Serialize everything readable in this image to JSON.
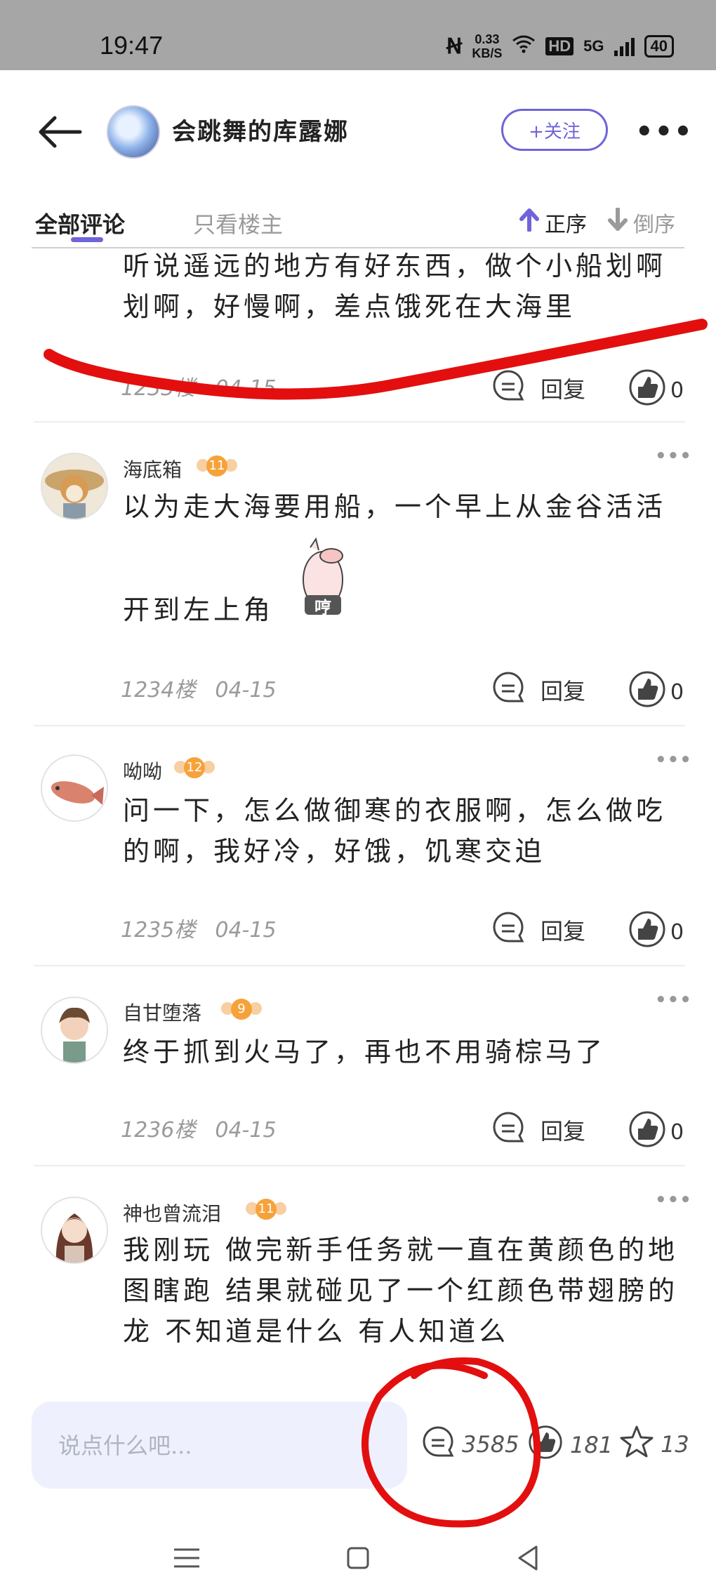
{
  "status_bar": {
    "time": "19:47",
    "net_speed_value": "0.33",
    "net_speed_unit": "KB/S",
    "hd": "HD",
    "network": "5G",
    "battery": "40"
  },
  "header": {
    "back_icon": "arrow-left-icon",
    "author": "会跳舞的库露娜",
    "follow_label": "+关注",
    "more_icon": "more-horizontal-icon"
  },
  "tabs": {
    "all_comments": "全部评论",
    "only_host": "只看楼主",
    "sort_asc": "正序",
    "sort_desc": "倒序"
  },
  "comments": [
    {
      "name": "",
      "text": "听说遥远的地方有好东西，做个小船划啊划啊，好慢啊，差点饿死在大海里",
      "floor": "1233楼",
      "date": "04-15",
      "reply_label": "回复",
      "likes": "0"
    },
    {
      "name": "海底箱",
      "level": "11",
      "text_line1": "以为走大海要用船，一个早上从金谷活活",
      "text_line2": "开到左上角",
      "sticker_text": "哼",
      "floor": "1234楼",
      "date": "04-15",
      "reply_label": "回复",
      "likes": "0"
    },
    {
      "name": "呦呦",
      "level": "12",
      "text": "问一下，怎么做御寒的衣服啊，怎么做吃的啊，我好冷，好饿，饥寒交迫",
      "floor": "1235楼",
      "date": "04-15",
      "reply_label": "回复",
      "likes": "0"
    },
    {
      "name": "自甘堕落",
      "level": "9",
      "text": "终于抓到火马了，再也不用骑棕马了",
      "floor": "1236楼",
      "date": "04-15",
      "reply_label": "回复",
      "likes": "0"
    },
    {
      "name": "神也曾流泪",
      "level": "11",
      "text": "我刚玩 做完新手任务就一直在黄颜色的地图瞎跑 结果就碰见了一个红颜色带翅膀的龙 不知道是什么 有人知道么"
    }
  ],
  "bottom_bar": {
    "input_placeholder": "说点什么吧...",
    "comment_count": "3585",
    "like_count": "181",
    "star_count": "13"
  },
  "colors": {
    "accent": "#6f64d8",
    "annotation_red": "#e30f0f",
    "badge_orange": "#f6a23a"
  }
}
